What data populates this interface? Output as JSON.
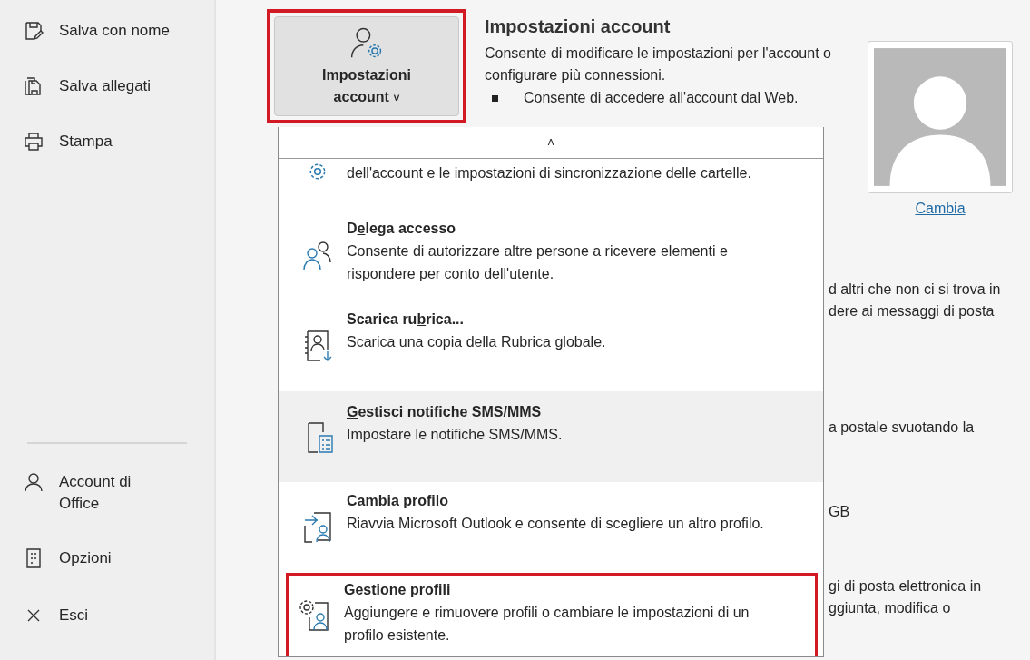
{
  "sidebar": {
    "items": [
      {
        "label": "Salva con nome"
      },
      {
        "label": "Salva allegati"
      },
      {
        "label": "Stampa"
      }
    ],
    "bottom_items": [
      {
        "label": "Account di Office"
      },
      {
        "label": "Opzioni"
      },
      {
        "label": "Esci"
      }
    ]
  },
  "account_button": {
    "label": "Impostazioni account",
    "caret": "˅",
    "highlighted": true
  },
  "account_info": {
    "title": "Impostazioni account",
    "description": "Consente di modificare le impostazioni per l'account o configurare più connessioni.",
    "bullets": [
      "Consente di accedere all'account dal Web."
    ]
  },
  "profile_picture": {
    "link": "Cambia"
  },
  "background_fragments": [
    [
      "d altri che non ci si trova in",
      "dere ai messaggi di posta"
    ],
    [
      "a postale svuotando la"
    ],
    [
      "GB"
    ],
    [
      "gi di posta elettronica in",
      "ggiunta, modifica o"
    ]
  ],
  "menu": {
    "scroll_up": "˄",
    "items": [
      {
        "description": "dell'account e le impostazioni di sincronizzazione delle cartelle.",
        "hovered": false,
        "highlighted": false
      },
      {
        "title_before": "D",
        "access_key": "e",
        "title_after": "lega accesso",
        "description": "Consente di autorizzare altre persone a ricevere elementi e rispondere per conto dell'utente.",
        "hovered": false,
        "highlighted": false
      },
      {
        "title_before": "Scarica ru",
        "access_key": "b",
        "title_after": "rica...",
        "description": "Scarica una copia della Rubrica globale.",
        "hovered": false,
        "highlighted": false
      },
      {
        "access_key": "G",
        "title_after": "estisci notifiche SMS/MMS",
        "description": "Impostare le notifiche SMS/MMS.",
        "hovered": true,
        "highlighted": false
      },
      {
        "title_before": "Cambia profilo",
        "description": "Riavvia Microsoft Outlook e consente di scegliere un altro profilo.",
        "hovered": false,
        "highlighted": false
      },
      {
        "title_before": "Gestione pr",
        "access_key": "o",
        "title_after": "fili",
        "description": "Aggiungere e rimuovere profili o cambiare le impostazioni di un profilo esistente.",
        "hovered": false,
        "highlighted": true
      }
    ]
  }
}
